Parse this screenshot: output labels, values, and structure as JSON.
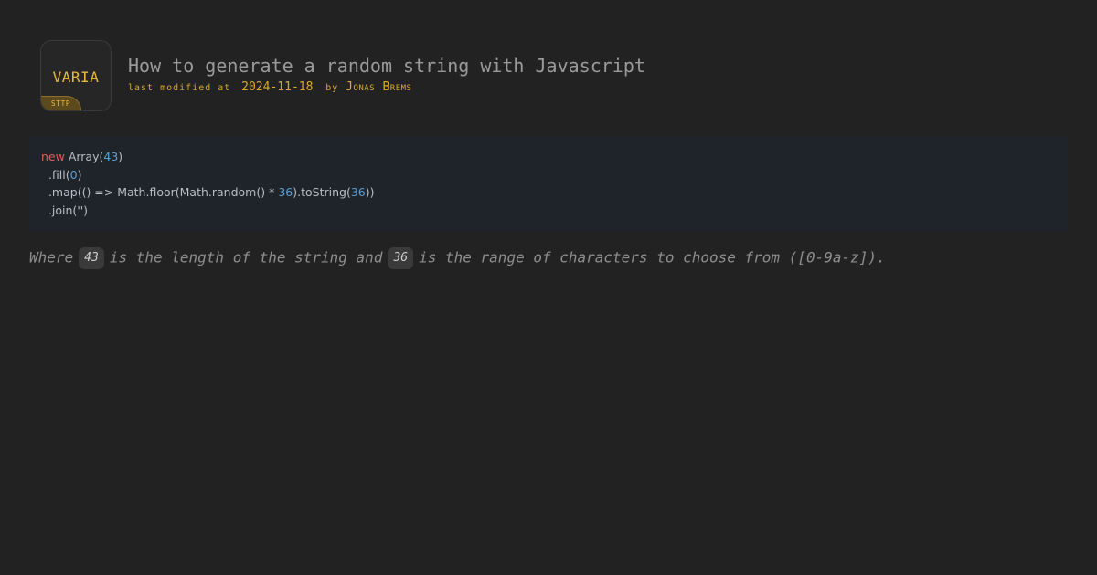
{
  "logo": {
    "text": "VARIA",
    "badge": "STTP"
  },
  "header": {
    "title": "How to generate a random string with Javascript",
    "modified_label": "last modified at",
    "date": "2024-11-18",
    "by_label": "by",
    "author": "Jonas Brems"
  },
  "code": {
    "line1": {
      "kw": "new",
      "a": " Array(",
      "n": "43",
      "b": ")"
    },
    "line2": {
      "a": "  .fill(",
      "n": "0",
      "b": ")"
    },
    "line3": {
      "a": "  .map(() => Math.floor(Math.random() * ",
      "n1": "36",
      "b": ").toString(",
      "n2": "36",
      "c": "))"
    },
    "line4": {
      "a": "  .join('')"
    }
  },
  "description": {
    "part1": "Where",
    "value1": "43",
    "part2": "is the length of the string and",
    "value2": "36",
    "part3": "is the range of characters to choose from ([0-9a-z])."
  },
  "colors": {
    "background": "#222222",
    "accent": "#d9a92c",
    "code_background": "#1f242b",
    "keyword": "#d9625b",
    "number": "#5a9fd6"
  }
}
